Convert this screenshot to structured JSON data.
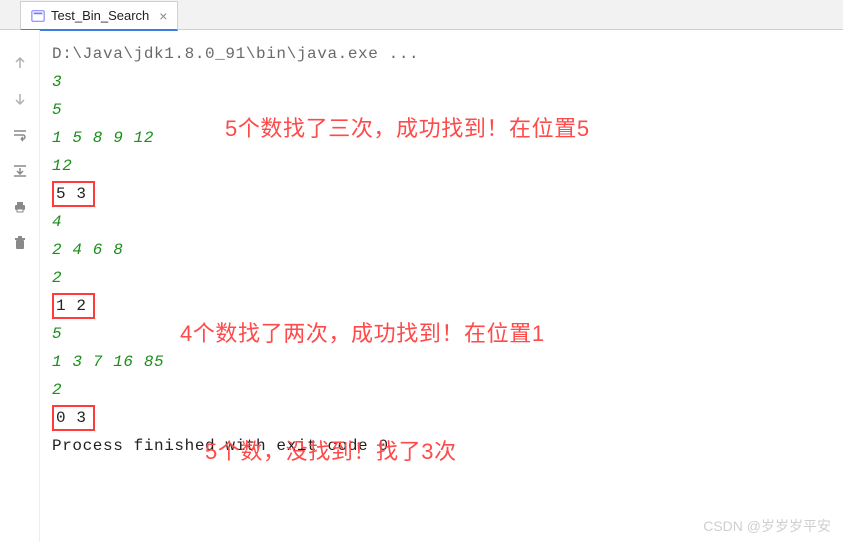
{
  "tab": {
    "title": "Test_Bin_Search",
    "close_glyph": "×"
  },
  "console": {
    "cmd": "D:\\Java\\jdk1.8.0_91\\bin\\java.exe ...",
    "lines": [
      "3",
      "5",
      "1 5 8 9 12",
      "12",
      "5 3",
      "4",
      "2 4 6 8",
      "2",
      "1 2",
      "5",
      "1 3 7 16 85",
      "2",
      "0 3"
    ],
    "exit": "Process finished with exit code 0"
  },
  "annotations": {
    "a1": "5个数找了三次，成功找到！在位置5",
    "a2": "4个数找了两次，成功找到！在位置1",
    "a3": "5个数，没找到！找了3次"
  },
  "watermark": "CSDN @岁岁岁平安"
}
